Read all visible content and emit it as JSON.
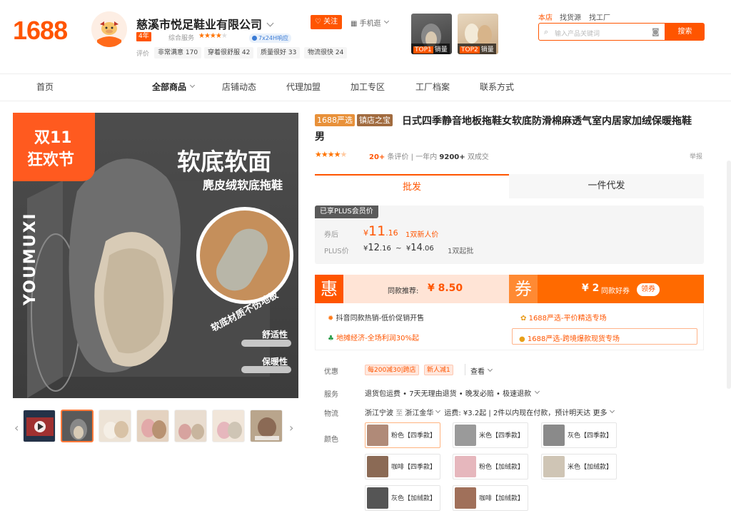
{
  "header": {
    "logo": "1688",
    "company": "慈溪市悦足鞋业有限公司",
    "years": "4年",
    "composite_label": "综合服务",
    "service24": "7x24H响应",
    "eval_label": "评价",
    "eval_chips": [
      "非常满意 170",
      "穿着很舒服 42",
      "质量很好 33",
      "物流很快 24"
    ],
    "follow": "关注",
    "mobile": "手机逛",
    "top_items": [
      {
        "rank": "TOP1",
        "label": "销量"
      },
      {
        "rank": "TOP2",
        "label": "销量"
      }
    ],
    "search_tabs": [
      "本店",
      "找货源",
      "找工厂"
    ],
    "search_placeholder": "输入产品关键词",
    "search_button": "搜索"
  },
  "nav": [
    "首页",
    "全部商品",
    "店铺动态",
    "代理加盟",
    "加工专区",
    "工厂档案",
    "联系方式"
  ],
  "image": {
    "promo_line1": "双11",
    "promo_line2": "狂欢节",
    "headline": "软底软面",
    "subline": "麂皮绒软底拖鞋",
    "brand": "YOUMUXI",
    "ring_text": "软底材质不伤地板",
    "feat1": "舒适性",
    "feat2": "保暖性"
  },
  "product": {
    "tag1": "1688严选",
    "tag2": "镇店之宝",
    "title": "日式四季静音地板拖鞋女软底防滑棉麻透气室内居家加绒保暖拖鞋男",
    "reviews": "20+",
    "reviews_label": "条评价",
    "year_label": "一年内",
    "sold": "9200+",
    "sold_label": "双成交",
    "report": "举报",
    "tab_wholesale": "批发",
    "tab_dropship": "一件代发",
    "plus_badge": "已享PLUS会员价",
    "coupon_price_label": "券后",
    "coupon_price": "11",
    "coupon_price_dec": ".16",
    "coupon_note": "1双新人价",
    "plus_price_label": "PLUS价",
    "plus_low": "12",
    "plus_low_dec": ".16",
    "plus_high": "14",
    "plus_high_dec": ".06",
    "plus_note": "1双起批",
    "hui": "惠",
    "recommend_label": "同款推荐:",
    "recommend_price": "¥ 8.50",
    "quan": "券",
    "coupon_amount": "¥ 2",
    "coupon_label": "同款好券",
    "coupon_claim": "领券",
    "promo_items": [
      "抖音同款热销-低价促销开售",
      "地摊经济-全场利润30%起",
      "1688严选-平价精选专场",
      "1688严选-跨境爆款现货专场"
    ],
    "discount_label": "优惠",
    "discount_tags": [
      "每200减30|跨店",
      "新人减1"
    ],
    "discount_view": "查看",
    "service_label": "服务",
    "service_text": "退货包运费 • 7天无理由退货 • 晚发必赔 • 极速退款",
    "logistics_label": "物流",
    "from": "浙江宁波",
    "to_label": "至",
    "to": "浙江金华",
    "freight": "运费: ¥3.2起",
    "ship_note": "2件以内现在付款，预计明天达",
    "more": "更多",
    "color_label": "颜色",
    "colors": [
      "粉色【四季款】",
      "米色【四季款】",
      "灰色【四季款】",
      "咖啡【四季款】",
      "粉色【加绒款】",
      "米色【加绒款】",
      "灰色【加绒款】",
      "咖啡【加绒款】"
    ],
    "swatch_colors": [
      "#b08a78",
      "#9a9a9a",
      "#8a8a8a",
      "#8b6a55",
      "#e6b7bd",
      "#cfc5b5",
      "#555555",
      "#a0705a"
    ]
  }
}
